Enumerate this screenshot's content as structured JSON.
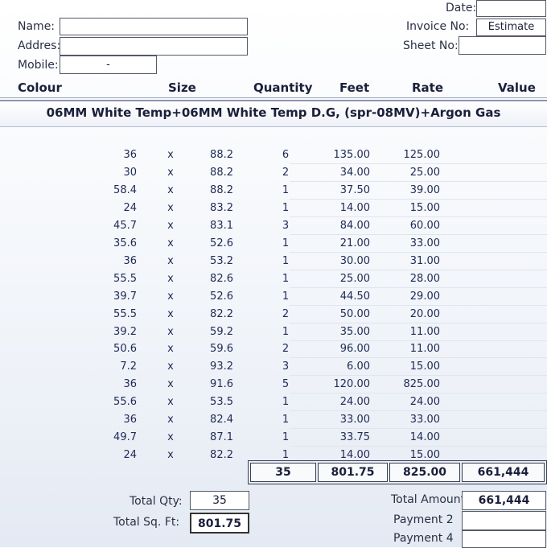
{
  "header": {
    "name_label": "Name:",
    "address_label": "Addres:",
    "mobile_label": "Mobile:",
    "mobile_value": "-",
    "date_label": "Date:",
    "invoice_label": "Invoice No:",
    "invoice_value": "Estimate",
    "sheet_label": "Sheet No:"
  },
  "columns": [
    "Colour",
    "Size",
    "Quantity",
    "Feet",
    "Rate",
    "Value"
  ],
  "product_title": "06MM White Temp+06MM White Temp D.G, (spr-08MV)+Argon Gas",
  "rows": [
    {
      "w": "36",
      "x": "x",
      "h": "88.2",
      "qty": "6",
      "feet": "135.00",
      "rate": "125.00"
    },
    {
      "w": "30",
      "x": "x",
      "h": "88.2",
      "qty": "2",
      "feet": "34.00",
      "rate": "25.00"
    },
    {
      "w": "58.4",
      "x": "x",
      "h": "88.2",
      "qty": "1",
      "feet": "37.50",
      "rate": "39.00"
    },
    {
      "w": "24",
      "x": "x",
      "h": "83.2",
      "qty": "1",
      "feet": "14.00",
      "rate": "15.00"
    },
    {
      "w": "45.7",
      "x": "x",
      "h": "83.1",
      "qty": "3",
      "feet": "84.00",
      "rate": "60.00"
    },
    {
      "w": "35.6",
      "x": "x",
      "h": "52.6",
      "qty": "1",
      "feet": "21.00",
      "rate": "33.00"
    },
    {
      "w": "36",
      "x": "x",
      "h": "53.2",
      "qty": "1",
      "feet": "30.00",
      "rate": "31.00"
    },
    {
      "w": "55.5",
      "x": "x",
      "h": "82.6",
      "qty": "1",
      "feet": "25.00",
      "rate": "28.00"
    },
    {
      "w": "39.7",
      "x": "x",
      "h": "52.6",
      "qty": "1",
      "feet": "44.50",
      "rate": "29.00"
    },
    {
      "w": "55.5",
      "x": "x",
      "h": "82.2",
      "qty": "2",
      "feet": "50.00",
      "rate": "20.00"
    },
    {
      "w": "39.2",
      "x": "x",
      "h": "59.2",
      "qty": "1",
      "feet": "35.00",
      "rate": "11.00"
    },
    {
      "w": "50.6",
      "x": "x",
      "h": "59.6",
      "qty": "2",
      "feet": "96.00",
      "rate": "11.00"
    },
    {
      "w": "7.2",
      "x": "x",
      "h": "93.2",
      "qty": "3",
      "feet": "6.00",
      "rate": "15.00"
    },
    {
      "w": "36",
      "x": "x",
      "h": "91.6",
      "qty": "5",
      "feet": "120.00",
      "rate": "825.00"
    },
    {
      "w": "55.6",
      "x": "x",
      "h": "53.5",
      "qty": "1",
      "feet": "24.00",
      "rate": "24.00"
    },
    {
      "w": "36",
      "x": "x",
      "h": "82.4",
      "qty": "1",
      "feet": "33.00",
      "rate": "33.00"
    },
    {
      "w": "49.7",
      "x": "x",
      "h": "87.1",
      "qty": "1",
      "feet": "33.75",
      "rate": "14.00"
    },
    {
      "w": "24",
      "x": "x",
      "h": "82.2",
      "qty": "1",
      "feet": "14.00",
      "rate": "15.00"
    }
  ],
  "totals_row": {
    "qty": "35",
    "feet": "801.75",
    "rate": "825.00",
    "value": "661,444"
  },
  "summary": {
    "total_qty_label": "Total Qty:",
    "total_qty": "35",
    "total_sqft_label": "Total Sq. Ft:",
    "total_sqft": "801.75",
    "total_amount_label": "Total Amount",
    "total_amount": "661,444",
    "payment2_label": "Payment 2",
    "payment4_label": "Payment 4"
  }
}
